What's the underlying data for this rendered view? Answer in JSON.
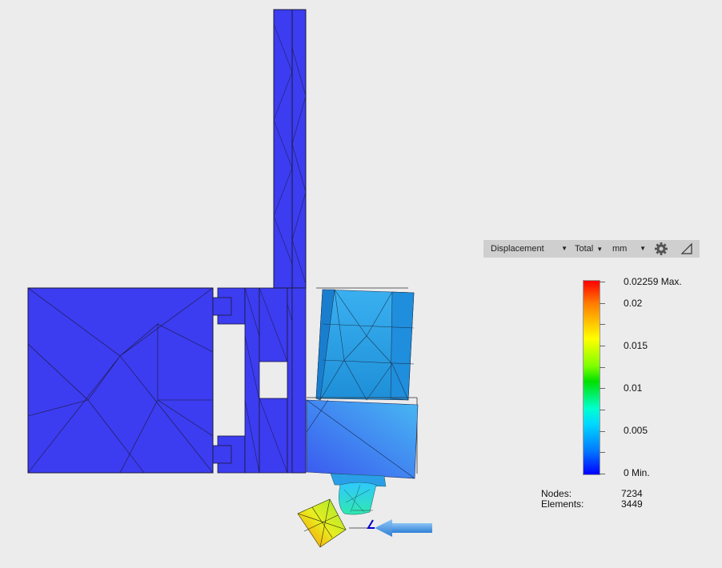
{
  "toolbar": {
    "result_type": "Displacement",
    "component": "Total",
    "units": "mm",
    "settings_icon": "gear-icon",
    "corner_icon": "triangle-corner-icon"
  },
  "legend": {
    "max_label": "0.02259 Max.",
    "labels": [
      "0.02",
      "0.015",
      "0.01",
      "0.005"
    ],
    "min_label": "0 Min."
  },
  "stats": {
    "nodes_label": "Nodes:",
    "nodes_value": "7234",
    "elements_label": "Elements:",
    "elements_value": "3449"
  },
  "colors": {
    "background": "#ececec",
    "undeformed_blue": "#3c3cf0",
    "load_arrow": "#4a90e2"
  }
}
